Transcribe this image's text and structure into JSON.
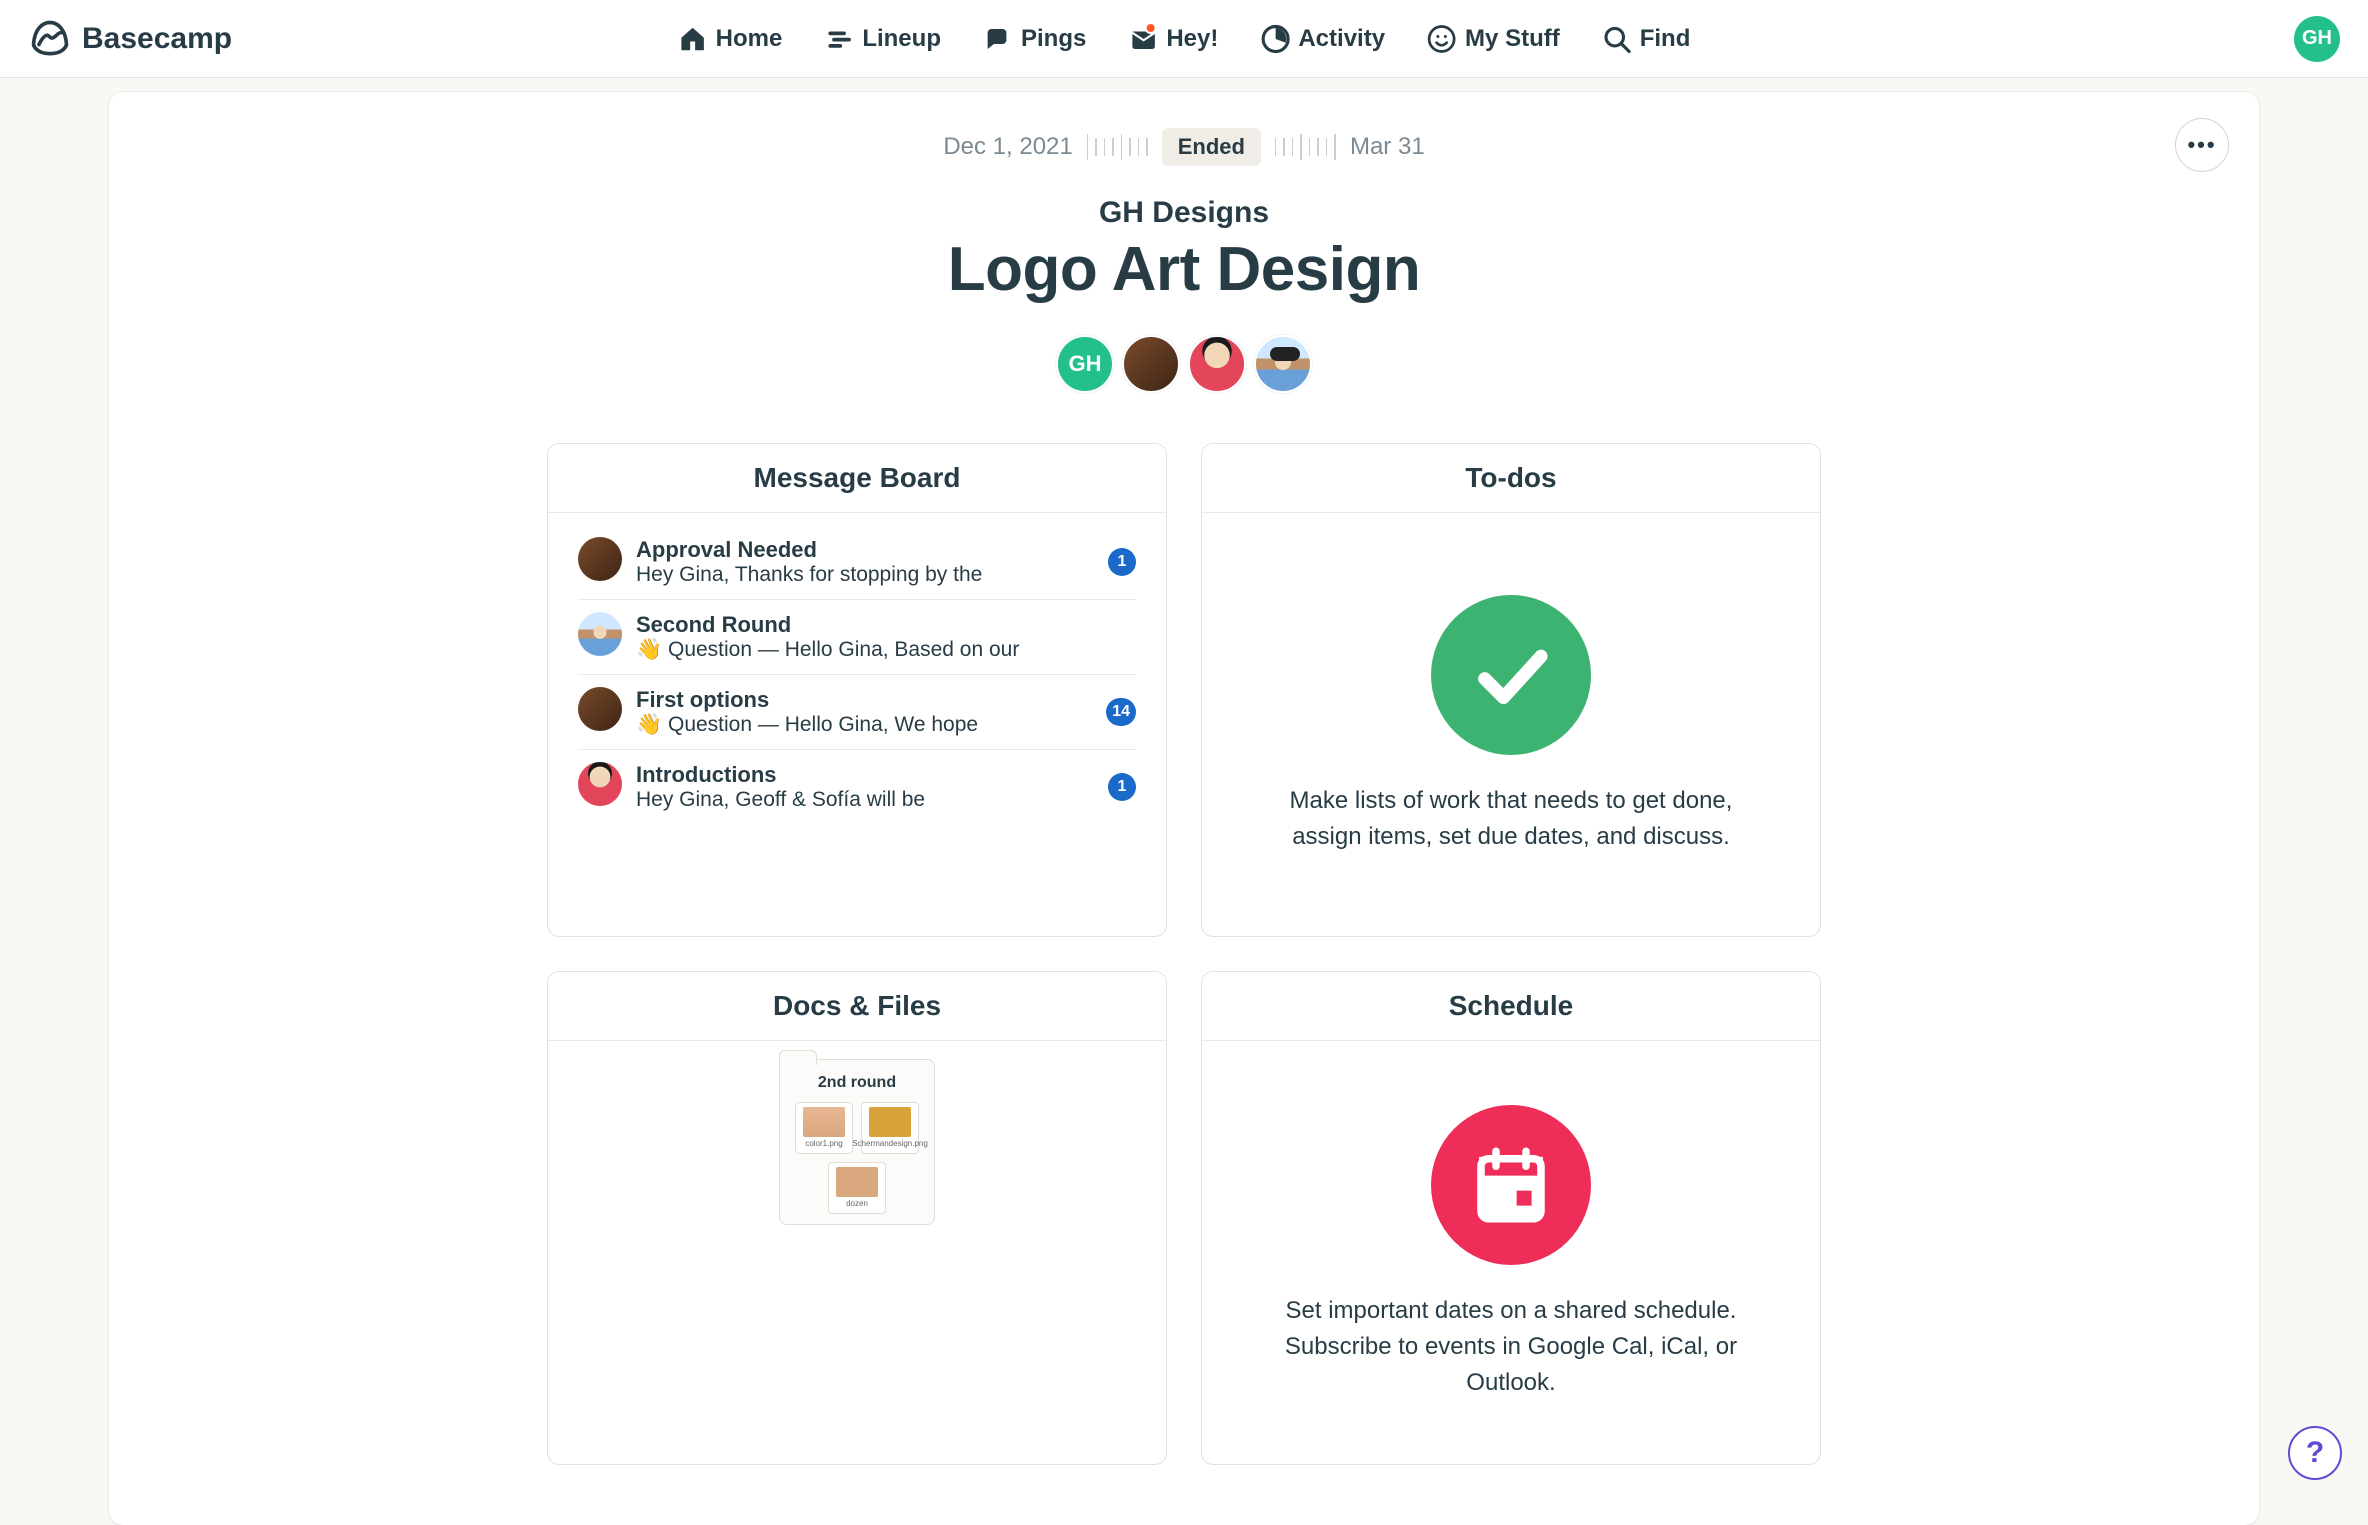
{
  "brand": {
    "name": "Basecamp"
  },
  "nav": {
    "home": "Home",
    "lineup": "Lineup",
    "pings": "Pings",
    "hey": "Hey!",
    "activity": "Activity",
    "mystuff": "My Stuff",
    "find": "Find"
  },
  "user": {
    "initials": "GH"
  },
  "timeline": {
    "start": "Dec 1, 2021",
    "status": "Ended",
    "end": "Mar 31"
  },
  "org": "GH Designs",
  "project": "Logo Art Design",
  "members": [
    {
      "kind": "gh",
      "initials": "GH"
    },
    {
      "kind": "brown"
    },
    {
      "kind": "pink"
    },
    {
      "kind": "photo"
    }
  ],
  "cards": {
    "message_board": {
      "title": "Message Board",
      "items": [
        {
          "avatar": "brown",
          "title": "Approval Needed",
          "preview": "Hey Gina, Thanks for stopping by the",
          "badge": "1"
        },
        {
          "avatar": "photo",
          "title": "Second Round",
          "preview": "👋 Question — Hello Gina, Based on our",
          "badge": ""
        },
        {
          "avatar": "brown",
          "title": "First options",
          "preview": "👋 Question — Hello Gina, We hope",
          "badge": "14"
        },
        {
          "avatar": "pink",
          "title": "Introductions",
          "preview": "Hey Gina, Geoff & Sofía will be",
          "badge": "1"
        }
      ]
    },
    "todos": {
      "title": "To-dos",
      "desc": "Make lists of work that needs to get done, assign items, set due dates, and discuss."
    },
    "docs": {
      "title": "Docs & Files",
      "folder": {
        "name": "2nd round",
        "files": [
          {
            "label": "color1.png",
            "style": "a"
          },
          {
            "label": "Schermandesign.png",
            "style": "b"
          },
          {
            "label": "dozen",
            "style": "c"
          }
        ]
      }
    },
    "schedule": {
      "title": "Schedule",
      "desc": "Set important dates on a shared schedule. Subscribe to events in Google Cal, iCal, or Outlook."
    }
  },
  "more_label": "•••",
  "help_label": "?"
}
